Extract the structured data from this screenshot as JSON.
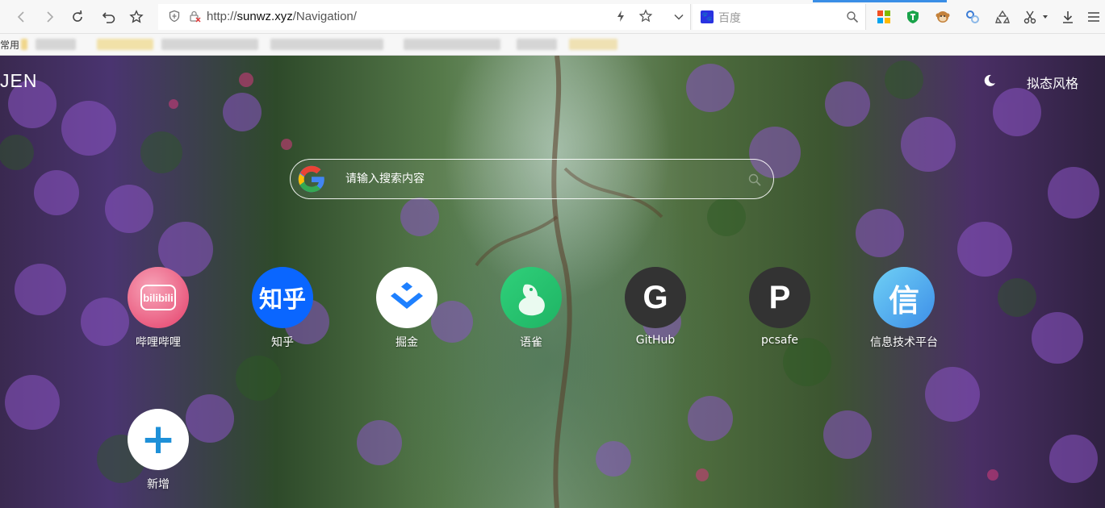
{
  "browser": {
    "url_prefix": "http://",
    "url_domain": "sunwz.xyz",
    "url_path": "/Navigation/",
    "search_engine_placeholder": "百度",
    "bookmarks_label": "常用"
  },
  "header": {
    "logo_text": "JEN",
    "style_toggle_label": "拟态风格"
  },
  "search": {
    "placeholder": "请输入搜索内容"
  },
  "sites": [
    {
      "label": "哔哩哔哩",
      "icon_text": "bilibili",
      "icon": "bilibili-icon",
      "color": "#f0728f"
    },
    {
      "label": "知乎",
      "icon_text": "知乎",
      "icon": "zhihu-icon",
      "color": "#0a66ff"
    },
    {
      "label": "掘金",
      "icon_text": "",
      "icon": "juejin-icon",
      "color": "#1e80ff"
    },
    {
      "label": "语雀",
      "icon_text": "",
      "icon": "yuque-icon",
      "color": "#31cc79"
    },
    {
      "label": "GitHub",
      "icon_text": "G",
      "icon": "github-letter-icon",
      "color": "#333333"
    },
    {
      "label": "pcsafe",
      "icon_text": "P",
      "icon": "pcsafe-letter-icon",
      "color": "#333333"
    },
    {
      "label": "信息技术平台",
      "icon_text": "信",
      "icon": "xin-letter-icon",
      "color": "#44a6ee"
    },
    {
      "label": "新增",
      "icon_text": "+",
      "icon": "add-icon",
      "color": "#1e90d8"
    }
  ]
}
